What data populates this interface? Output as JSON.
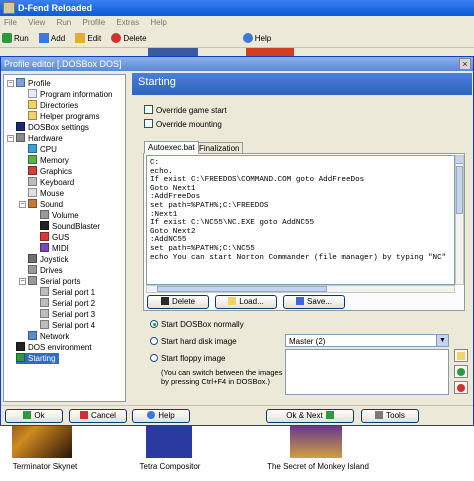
{
  "app": {
    "title": "D-Fend Reloaded",
    "menu": [
      "File",
      "View",
      "Run",
      "Profile",
      "Extras",
      "Help"
    ],
    "toolbar": [
      {
        "label": "Run",
        "icon": "run-icon"
      },
      {
        "label": "Add",
        "icon": "add-icon"
      },
      {
        "label": "Edit",
        "icon": "edit-icon"
      },
      {
        "label": "Delete",
        "icon": "delete-icon"
      },
      {
        "label": "Help",
        "icon": "help-icon"
      }
    ]
  },
  "dialog": {
    "title": "Profile editor [.DOSBox DOS]",
    "close": "×",
    "tree": [
      {
        "label": "Profile",
        "color": "#7ea0d8"
      },
      {
        "label": "Program information",
        "color": "#e8e8f8"
      },
      {
        "label": "Directories",
        "color": "#f2d36b"
      },
      {
        "label": "Helper programs",
        "color": "#f2d36b"
      },
      {
        "label": "DOSBox settings",
        "color": "#1b2a6e"
      },
      {
        "label": "Hardware",
        "color": "#8a8a8a"
      },
      {
        "label": "CPU",
        "color": "#3aa0d8"
      },
      {
        "label": "Memory",
        "color": "#59b34a"
      },
      {
        "label": "Graphics",
        "color": "#d04040"
      },
      {
        "label": "Keyboard",
        "color": "#bdbdbd"
      },
      {
        "label": "Mouse",
        "color": "#e0e0e0"
      },
      {
        "label": "Sound",
        "color": "#c07a3a"
      },
      {
        "label": "Volume",
        "color": "#9a9a9a"
      },
      {
        "label": "SoundBlaster",
        "color": "#222222"
      },
      {
        "label": "GUS",
        "color": "#d83a3a"
      },
      {
        "label": "MIDI",
        "color": "#7a4ab0"
      },
      {
        "label": "Joystick",
        "color": "#707070"
      },
      {
        "label": "Drives",
        "color": "#9a9a9a"
      },
      {
        "label": "Serial ports",
        "color": "#9a9a9a"
      },
      {
        "label": "Serial port 1",
        "color": "#bdbdbd"
      },
      {
        "label": "Serial port 2",
        "color": "#bdbdbd"
      },
      {
        "label": "Serial port 3",
        "color": "#bdbdbd"
      },
      {
        "label": "Serial port 4",
        "color": "#bdbdbd"
      },
      {
        "label": "Network",
        "color": "#5a8ad0"
      },
      {
        "label": "DOS environment",
        "color": "#222222"
      },
      {
        "label": "Starting",
        "color": "#2e9a3e"
      }
    ],
    "panel_title": "Starting",
    "override_game_start": "Override game start",
    "override_mounting": "Override mounting",
    "tabs": [
      "Autoexec.bat",
      "Finalization"
    ],
    "autoexec_lines": [
      "C:",
      "echo.",
      "",
      "If exist C:\\FREEDOS\\COMMAND.COM goto AddFreeDos",
      "Goto Next1",
      ":AddFreeDos",
      "set path=%PATH%;C:\\FREEDOS",
      ":Next1",
      "",
      "If exist C:\\NC55\\NC.EXE goto AddNC55",
      "Goto Next2",
      ":AddNC55",
      "set path=%PATH%;C:\\NC55",
      "echo You can start Norton Commander (file manager) by typing \"NC\""
    ],
    "buttons": {
      "delete": "Delete",
      "load": "Load...",
      "save": "Save..."
    },
    "start_dosbox": "Start DOSBox normally",
    "start_hdd": "Start hard disk image",
    "hdd_value": "Master (2)",
    "start_floppy": "Start floppy image",
    "floppy_hint": "(You can switch between the images\nby pressing Ctrl+F4 in DOSBox.)",
    "footer": {
      "ok": "Ok",
      "cancel": "Cancel",
      "help": "Help",
      "ok_next": "Ok & Next",
      "tools": "Tools"
    }
  },
  "games": [
    "Terminator Skynet",
    "Tetra Compositor",
    "The Secret of Monkey Island"
  ]
}
